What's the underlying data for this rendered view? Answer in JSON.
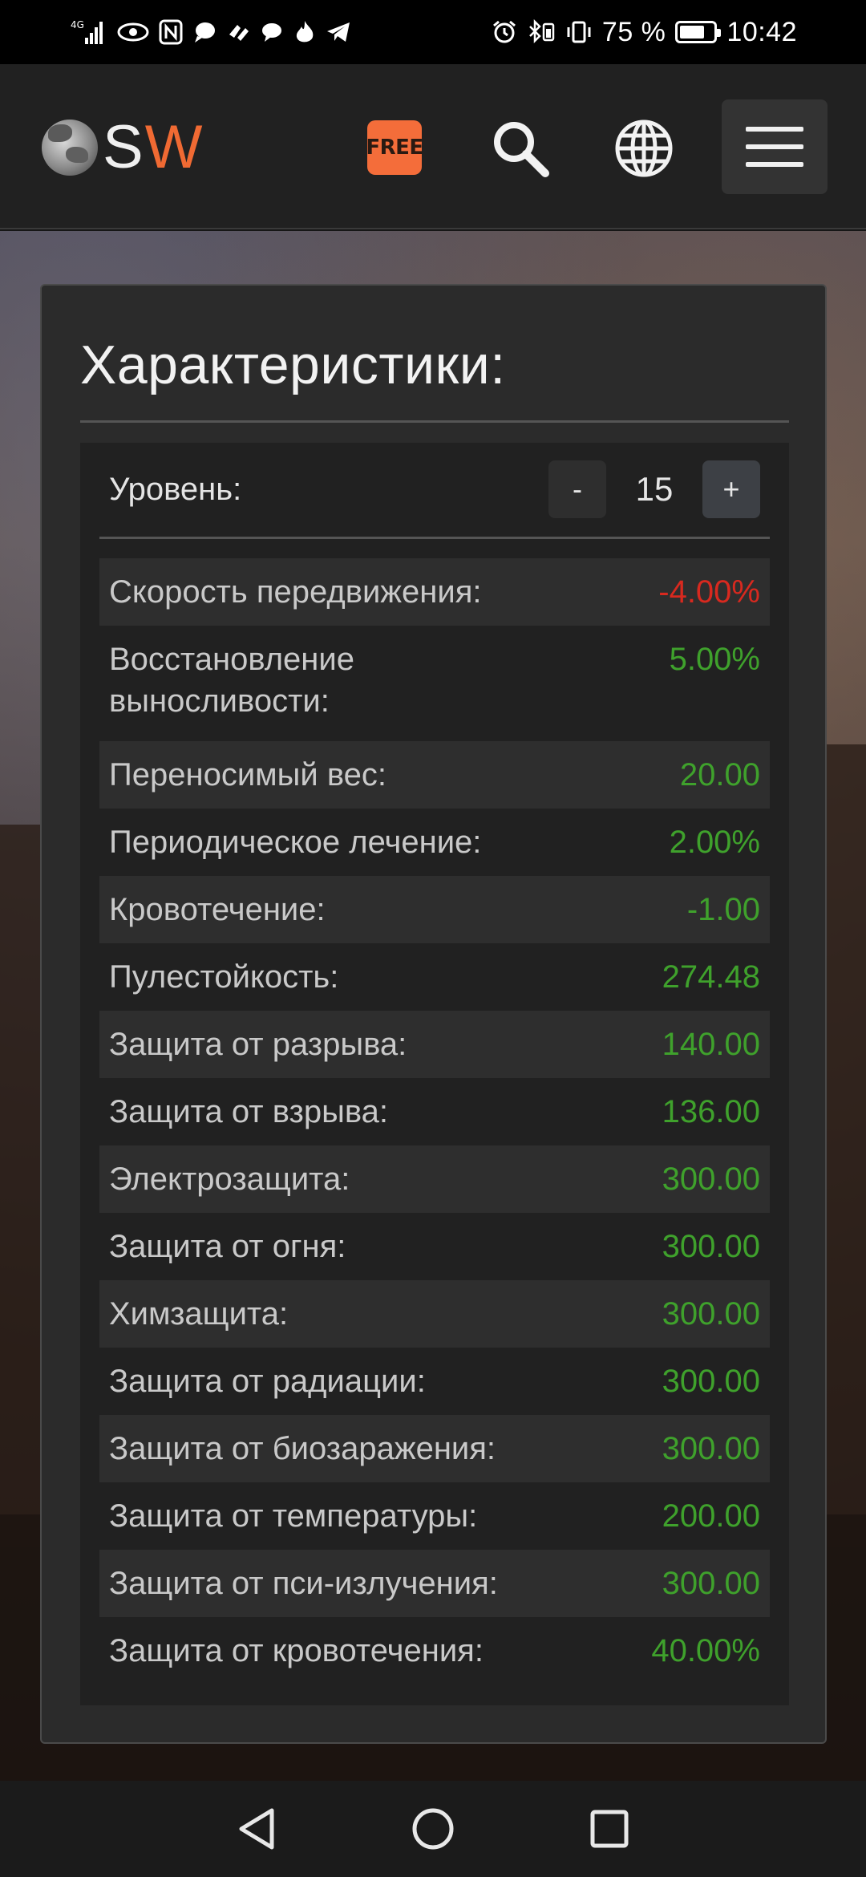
{
  "status_bar": {
    "network": "4G",
    "battery_percent": "75 %",
    "battery_level": 0.75,
    "time": "10:42"
  },
  "header": {
    "logo_s": "S",
    "logo_w": "W",
    "free_badge": "FREE",
    "accent_color": "#f06a33",
    "icons": [
      "search-icon",
      "globe-icon",
      "menu-icon"
    ]
  },
  "card": {
    "title": "Характеристики:",
    "level": {
      "label": "Уровень:",
      "minus_label": "-",
      "plus_label": "+",
      "value": "15"
    },
    "stats": [
      {
        "label": "Скорость передвижения:",
        "value": "-4.00%",
        "tone": "negative"
      },
      {
        "label": "Восстановление выносливости:",
        "value": "5.00%",
        "tone": "positive"
      },
      {
        "label": "Переносимый вес:",
        "value": "20.00",
        "tone": "positive"
      },
      {
        "label": "Периодическое лечение:",
        "value": "2.00%",
        "tone": "positive"
      },
      {
        "label": "Кровотечение:",
        "value": "-1.00",
        "tone": "positive"
      },
      {
        "label": "Пулестойкость:",
        "value": "274.48",
        "tone": "positive"
      },
      {
        "label": "Защита от разрыва:",
        "value": "140.00",
        "tone": "positive"
      },
      {
        "label": "Защита от взрыва:",
        "value": "136.00",
        "tone": "positive"
      },
      {
        "label": "Электрозащита:",
        "value": "300.00",
        "tone": "positive"
      },
      {
        "label": "Защита от огня:",
        "value": "300.00",
        "tone": "positive"
      },
      {
        "label": "Химзащита:",
        "value": "300.00",
        "tone": "positive"
      },
      {
        "label": "Защита от радиации:",
        "value": "300.00",
        "tone": "positive"
      },
      {
        "label": "Защита от биозаражения:",
        "value": "300.00",
        "tone": "positive"
      },
      {
        "label": "Защита от температуры:",
        "value": "200.00",
        "tone": "positive"
      },
      {
        "label": "Защита от пси-излучения:",
        "value": "300.00",
        "tone": "positive"
      },
      {
        "label": "Защита от кровотечения:",
        "value": "40.00%",
        "tone": "positive"
      }
    ],
    "colors": {
      "negative": "#d8291f",
      "positive": "#3fa12c"
    }
  },
  "nav": {
    "icons": [
      "back-icon",
      "home-icon",
      "recents-icon"
    ]
  }
}
